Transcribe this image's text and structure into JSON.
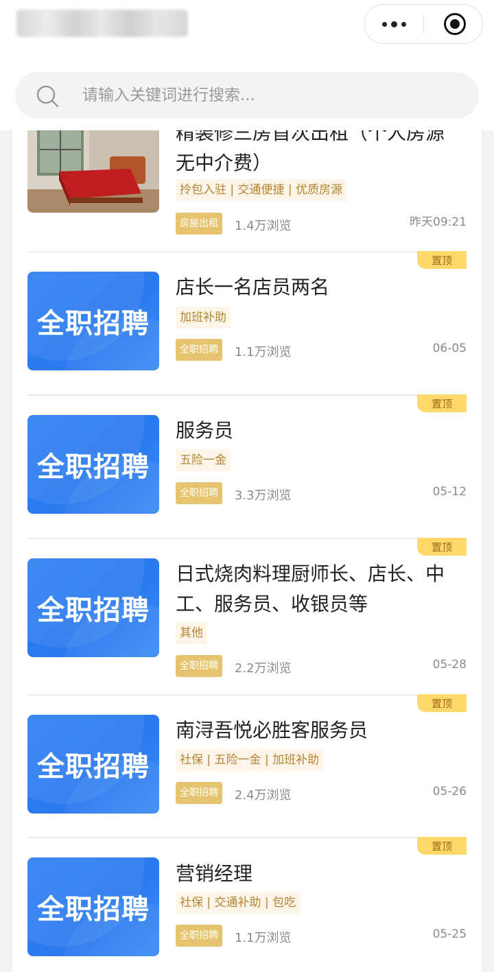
{
  "header": {
    "search_placeholder": "请输入关键词进行搜索..."
  },
  "listings": [
    {
      "title": "精装修三房首次出租（个人房源无中介费）",
      "title_visible": "无中介费）",
      "title_partial": "精装修三房首次出租（个人房源",
      "tags": "拎包入驻 | 交通便捷 | 优质房源",
      "category": "房屋出租",
      "views": "1.4万浏览",
      "date": "昨天09:21",
      "pinned": false,
      "thumb": "bedroom-photo"
    },
    {
      "title": "店长一名店员两名",
      "tags": "加班补助",
      "category": "全职招聘",
      "views": "1.1万浏览",
      "date": "06-05",
      "pinned": true,
      "pin_label": "置顶",
      "thumb_text": "全职招聘"
    },
    {
      "title": "服务员",
      "tags": "五险一金",
      "category": "全职招聘",
      "views": "3.3万浏览",
      "date": "05-12",
      "pinned": true,
      "pin_label": "置顶",
      "thumb_text": "全职招聘"
    },
    {
      "title": "日式烧肉料理厨师长、店长、中工、服务员、收银员等",
      "tags": "其他",
      "category": "全职招聘",
      "views": "2.2万浏览",
      "date": "05-28",
      "pinned": true,
      "pin_label": "置顶",
      "thumb_text": "全职招聘"
    },
    {
      "title": "南浔吾悦必胜客服务员",
      "tags": "社保 | 五险一金 | 加班补助",
      "category": "全职招聘",
      "views": "2.4万浏览",
      "date": "05-26",
      "pinned": true,
      "pin_label": "置顶",
      "thumb_text": "全职招聘"
    },
    {
      "title": "营销经理",
      "tags": "社保 | 交通补助 | 包吃",
      "category": "全职招聘",
      "views": "1.1万浏览",
      "date": "05-25",
      "pinned": true,
      "pin_label": "置顶",
      "thumb_text": "全职招聘"
    }
  ],
  "colors": {
    "badge_bg": "#ffd86a",
    "category_bg": "#e6c36e",
    "tag_text": "#b58435",
    "job_thumb_blue": "#2f7ff0"
  }
}
